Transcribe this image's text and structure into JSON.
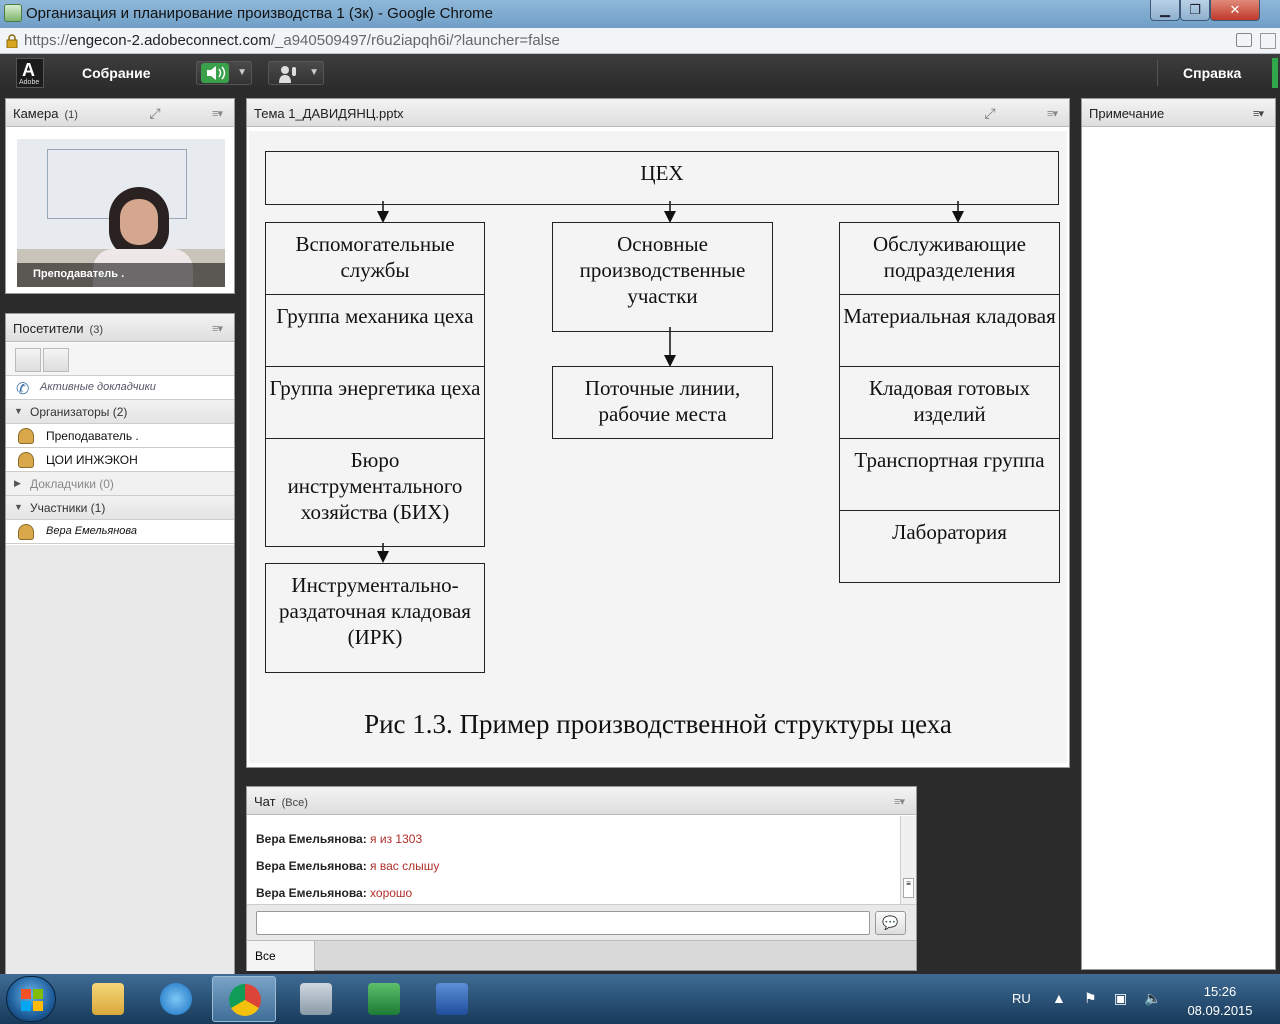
{
  "browser": {
    "window_title": "Организация и планирование производства 1 (3к) - Google Chrome",
    "url_prefix": "https://",
    "url_host": "engecon-2.adobeconnect.com",
    "url_path": "/_a940509497/r6u2iapqh6i/?launcher=false"
  },
  "connect_bar": {
    "logo_letter": "A",
    "logo_text": "Adobe",
    "meeting_label": "Собрание",
    "help_label": "Справка",
    "accent_color": "#2ea84a"
  },
  "camera_pod": {
    "title": "Камера",
    "count": "(1)",
    "presenter_name": "Преподаватель ."
  },
  "attendees_pod": {
    "title": "Посетители",
    "count": "(3)",
    "active_speakers": "Активные докладчики",
    "hosts_section": "Организаторы (2)",
    "hosts": [
      "Преподаватель .",
      "ЦОИ ИНЖЭКОН"
    ],
    "presenters_section": "Докладчики (0)",
    "participants_section": "Участники (1)",
    "participants": [
      "Вера Емельянова"
    ]
  },
  "share_pod": {
    "title": "Тема 1_ДАВИДЯНЦ.pptx",
    "slide": {
      "top_box": "ЦЕХ",
      "left_column": [
        "Вспомогательные службы",
        "Группа механика цеха",
        "Группа энергетика цеха",
        "Бюро инструментального хозяйства (БИХ)"
      ],
      "left_sub": "Инструментально-раздаточная кладовая (ИРК)",
      "middle_column": [
        "Основные производственные участки"
      ],
      "middle_sub": "Поточные линии, рабочие места",
      "right_column": [
        "Обслуживающие подразделения",
        "Материальная кладовая",
        "Кладовая готовых изделий",
        "Транспортная группа",
        "Лаборатория"
      ],
      "caption": "Рис 1.3. Пример производственной структуры цеха"
    }
  },
  "notes_pod": {
    "title": "Примечание"
  },
  "chat_pod": {
    "title": "Чат",
    "scope": "(Все)",
    "messages": [
      {
        "author": "Вера Емельянова:",
        "text": "я из 1303"
      },
      {
        "author": "Вера Емельянова:",
        "text": "я вас слышу"
      },
      {
        "author": "Вера Емельянова:",
        "text": "хорошо"
      }
    ],
    "input_value": "",
    "tab_all": "Все",
    "message_color": "#b0302b"
  },
  "taskbar": {
    "language": "RU",
    "time": "15:26",
    "date": "08.09.2015"
  }
}
